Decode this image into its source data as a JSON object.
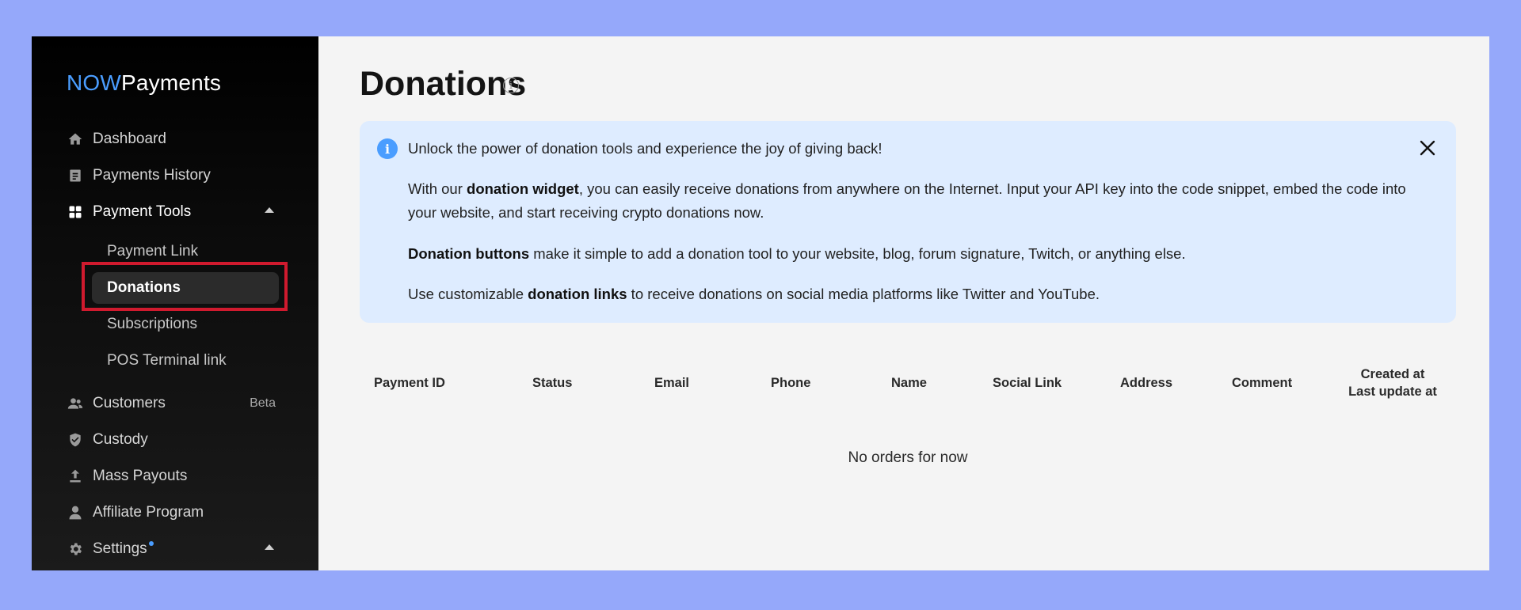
{
  "sidebar": {
    "logo_now": "NOW",
    "logo_payments": "Payments",
    "items": {
      "dashboard": "Dashboard",
      "payments_history": "Payments History",
      "payment_tools": "Payment Tools",
      "customers": "Customers",
      "customers_badge": "Beta",
      "custody": "Custody",
      "mass_payouts": "Mass Payouts",
      "affiliate_program": "Affiliate Program",
      "settings": "Settings"
    },
    "payment_tools_sub": {
      "payment_link": "Payment Link",
      "donations": "Donations",
      "subscriptions": "Subscriptions",
      "pos_terminal_link": "POS Terminal link"
    }
  },
  "main": {
    "title": "Donations",
    "banner": {
      "headline": "Unlock the power of donation tools and experience the joy of giving back!",
      "p1_pre": "With our ",
      "p1_bold": "donation widget",
      "p1_post": ", you can easily receive donations from anywhere on the Internet. Input your API key into the code snippet, embed the code into your website, and start receiving crypto donations now.",
      "p2_bold": "Donation buttons",
      "p2_post": " make it simple to add a donation tool to your website, blog, forum signature, Twitch, or anything else.",
      "p3_pre": "Use customizable ",
      "p3_bold": "donation links",
      "p3_post": " to receive donations on social media platforms like Twitter and YouTube."
    },
    "table": {
      "columns": [
        "Payment ID",
        "Status",
        "Email",
        "Phone",
        "Name",
        "Social Link",
        "Address",
        "Comment",
        "Created at",
        "Last update at"
      ],
      "empty_text": "No orders for now"
    }
  },
  "colors": {
    "background": "#95a8fa",
    "accent": "#4a9dff",
    "highlight": "#d01a2e"
  }
}
